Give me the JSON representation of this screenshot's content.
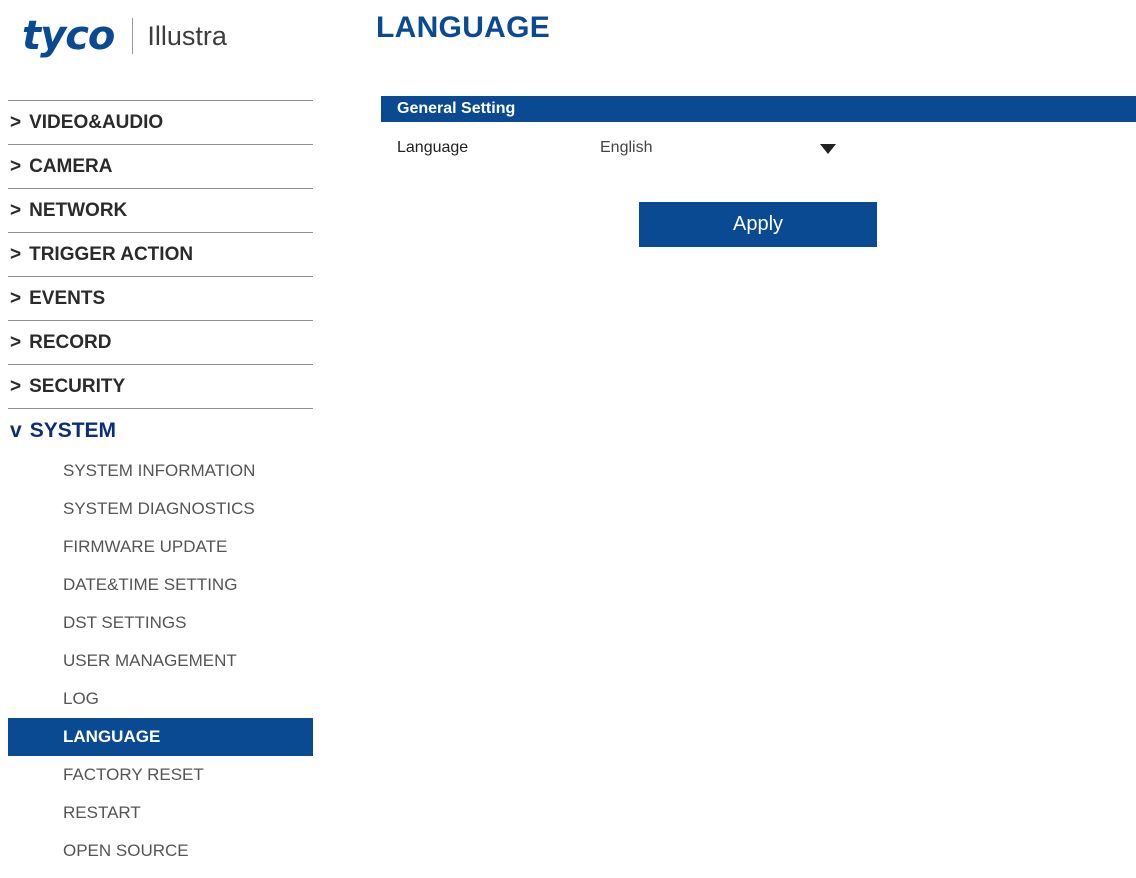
{
  "header": {
    "logo_brand": "tyco",
    "logo_product": "Illustra",
    "page_title": "LANGUAGE"
  },
  "sidebar": {
    "items": [
      {
        "chevron": ">",
        "label": "VIDEO&AUDIO"
      },
      {
        "chevron": ">",
        "label": "CAMERA"
      },
      {
        "chevron": ">",
        "label": "NETWORK"
      },
      {
        "chevron": ">",
        "label": "TRIGGER ACTION"
      },
      {
        "chevron": ">",
        "label": "EVENTS"
      },
      {
        "chevron": ">",
        "label": "RECORD"
      },
      {
        "chevron": ">",
        "label": "SECURITY"
      },
      {
        "chevron": "v",
        "label": "SYSTEM"
      }
    ],
    "system_subitems": [
      "SYSTEM INFORMATION",
      "SYSTEM DIAGNOSTICS",
      "FIRMWARE UPDATE",
      "DATE&TIME SETTING",
      "DST SETTINGS",
      "USER MANAGEMENT",
      "LOG",
      "LANGUAGE",
      "FACTORY RESET",
      "RESTART",
      "OPEN SOURCE"
    ],
    "active_subitem": "LANGUAGE"
  },
  "content": {
    "section_title": "General Setting",
    "language_label": "Language",
    "language_value": "English",
    "dropdown_icon": "triangle-down-icon",
    "apply_label": "Apply"
  },
  "colors": {
    "brand_blue": "#0a4a93",
    "expanded_section": "#0a2f78"
  }
}
